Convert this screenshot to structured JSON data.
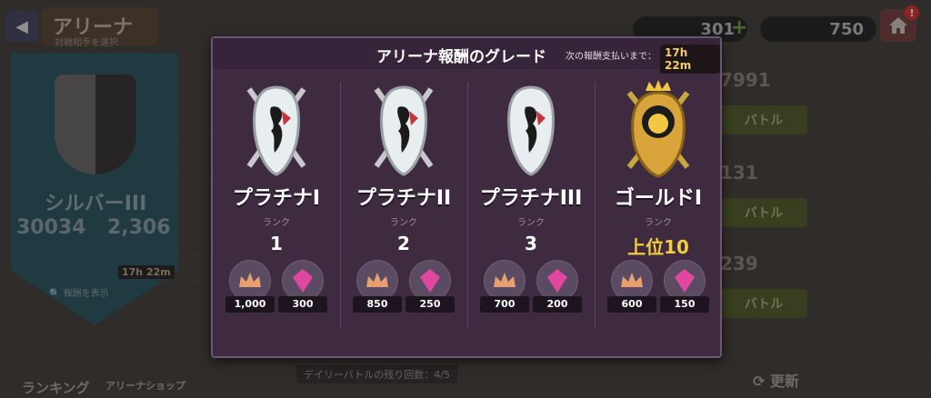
{
  "header": {
    "title": "アリーナ",
    "subtitle": "対戦相手を選択",
    "currency_a": "301",
    "currency_b": "750",
    "notification": "!"
  },
  "left_panel": {
    "rank": "シルバーIII",
    "score_a": "30034",
    "score_b": "2,306",
    "timer": "17h 22m",
    "view_rewards": "報酬を表示"
  },
  "opponents": [
    {
      "score": "7991",
      "battle_label": "バトル"
    },
    {
      "score": "131",
      "battle_label": "バトル"
    },
    {
      "score": "239",
      "battle_label": "バトル"
    }
  ],
  "bottom": {
    "ranking": "ランキング",
    "arena_shop": "アリーナショップ",
    "daily_battles": "デイリーバトルの残り回数：4/5",
    "refresh": "更新"
  },
  "modal": {
    "title": "アリーナ報酬のグレード",
    "payout_label": "次の報酬支払いまで：",
    "payout_time": "17h 22m",
    "grades": [
      {
        "name": "プラチナI",
        "rank_label": "ランク",
        "rank": "1",
        "crowns": "1,000",
        "gems": "300",
        "emblem": "platinum"
      },
      {
        "name": "プラチナII",
        "rank_label": "ランク",
        "rank": "2",
        "crowns": "850",
        "gems": "250",
        "emblem": "platinum"
      },
      {
        "name": "プラチナIII",
        "rank_label": "ランク",
        "rank": "3",
        "crowns": "700",
        "gems": "200",
        "emblem": "platinum"
      },
      {
        "name": "ゴールドI",
        "rank_label": "ランク",
        "rank": "上位10",
        "crowns": "600",
        "gems": "150",
        "emblem": "gold"
      }
    ]
  },
  "colors": {
    "modal_bg": "#3e2b40",
    "gold_text": "#f4cc3c",
    "timer_text": "#f4cc6a",
    "gem": "#e0479e",
    "crown": "#e8a070"
  }
}
